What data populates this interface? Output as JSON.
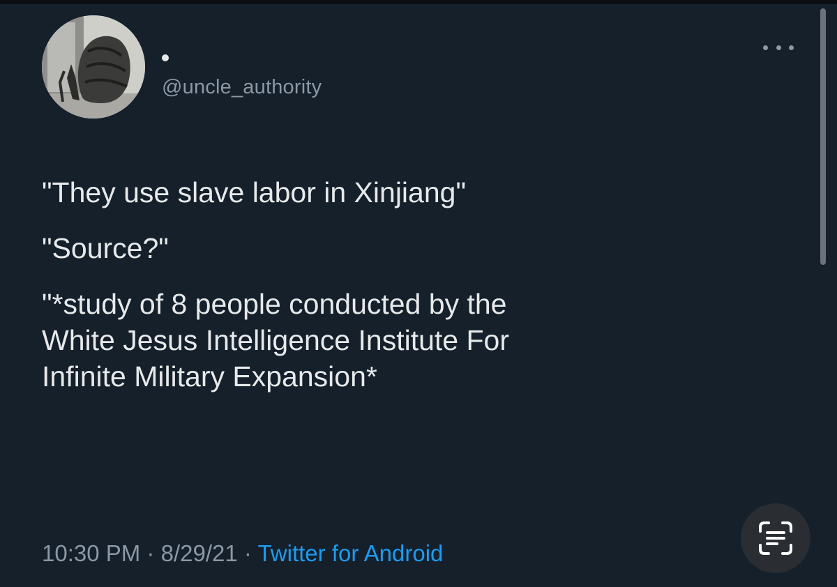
{
  "tweet": {
    "display_name": "",
    "handle": "@uncle_authority",
    "lines": [
      "\"They use slave labor in Xinjiang\"",
      "\"Source?\"",
      "\"*study of 8 people conducted by the\nWhite Jesus Intelligence Institute For\nInfinite Military Expansion*"
    ],
    "time": "10:30 PM",
    "date": "8/29/21",
    "separator": "·",
    "source": "Twitter for Android"
  },
  "icons": {
    "more": "more-horizontal-icon",
    "scan": "text-scan-icon"
  },
  "colors": {
    "background": "#15202b",
    "text": "#e7e9ea",
    "muted": "#8b98a5",
    "accent": "#1d9bf0"
  }
}
